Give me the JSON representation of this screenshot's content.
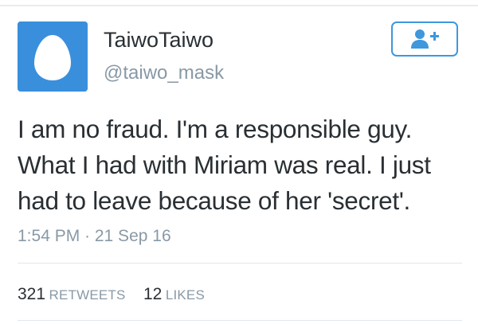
{
  "user": {
    "display_name": "TaiwoTaiwo",
    "handle": "@taiwo_mask",
    "avatar_icon": "default-egg-avatar"
  },
  "follow_button": {
    "icon": "add-user-icon",
    "color": "#3f97dc"
  },
  "tweet": {
    "lines": [
      "I am no fraud. I'm a responsible guy.",
      "What I had with Miriam was real. I just",
      "had to leave because of her 'secret'."
    ],
    "timestamp": "1:54 PM · 21 Sep 16"
  },
  "stats": {
    "retweets_count": "321",
    "retweets_label": "RETWEETS",
    "likes_count": "12",
    "likes_label": "LIKES"
  },
  "colors": {
    "avatar_bg": "#3a8fdc",
    "text": "#292f33",
    "muted": "#8899a6"
  }
}
